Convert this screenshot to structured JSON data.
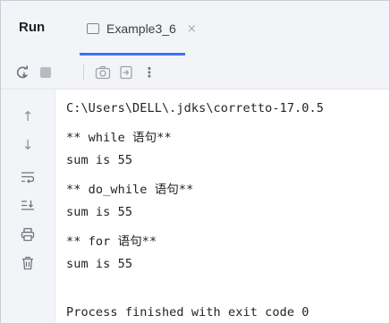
{
  "run_panel": {
    "title": "Run",
    "tab": {
      "label": "Example3_6",
      "close_glyph": "×"
    }
  },
  "toolbar": {
    "buttons": [
      "rerun-icon",
      "stop-icon",
      "camera-icon",
      "exit-icon",
      "more-icon"
    ],
    "more_glyph": "⋮"
  },
  "gutter": {
    "buttons": [
      "scroll-up-icon",
      "scroll-down-icon",
      "soft-wrap-icon",
      "scroll-to-end-icon",
      "print-icon",
      "clear-icon"
    ],
    "up_glyph": "↑",
    "down_glyph": "↓"
  },
  "console": {
    "lines": [
      "C:\\Users\\DELL\\.jdks\\corretto-17.0.5",
      "** while 语句**",
      "sum is 55",
      "** do_while 语句**",
      "sum is 55",
      "** for 语句**",
      "sum is 55",
      "",
      "Process finished with exit code 0"
    ]
  },
  "colors": {
    "accent": "#3d74f6",
    "panel_bg": "#f3f4f7",
    "icon": "#7d828c",
    "text": "#222326"
  }
}
